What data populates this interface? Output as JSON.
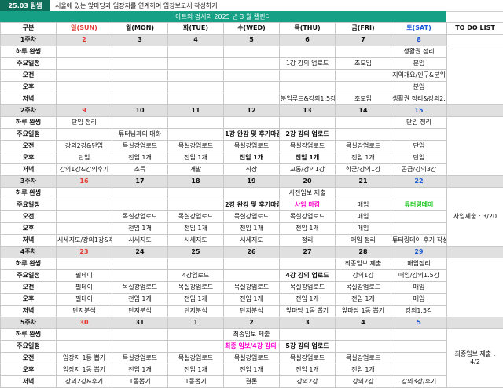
{
  "header": {
    "badge": "25.03 팀쌤",
    "headline": "서울에 있는 앞마당과 임장지를 연계하여 임장보고서 작성하기"
  },
  "title": "아트의 경서의 2025 년 3 월 캘린더",
  "columns": [
    "구분",
    "일(SUN)",
    "월(MON)",
    "화(TUE)",
    "수(WED)",
    "목(THU)",
    "금(FRI)",
    "토(SAT)",
    "TO DO LIST"
  ],
  "row_labels": [
    "하루 완씽",
    "주요일정",
    "오전",
    "오후",
    "저녁"
  ],
  "weeks": [
    {
      "label": "1주차",
      "dates": [
        "2",
        "3",
        "4",
        "5",
        "6",
        "7",
        "8"
      ],
      "rows": [
        [
          "",
          "",
          "",
          "",
          "",
          "",
          "생활권 정리"
        ],
        [
          "",
          "",
          "",
          "",
          "1강 강의 업로드",
          "조모임",
          "분임"
        ],
        [
          "",
          "",
          "",
          "",
          "",
          "",
          "지역개요/인구&분위"
        ],
        [
          "",
          "",
          "",
          "",
          "",
          "",
          "분임"
        ],
        [
          "",
          "",
          "",
          "",
          "분임루트&강의1.5강",
          "조모임",
          "생활권 정리&강의2.5강"
        ]
      ],
      "todo": ""
    },
    {
      "label": "2주차",
      "dates": [
        "9",
        "10",
        "11",
        "12",
        "13",
        "14",
        "15"
      ],
      "rows": [
        [
          "단임 정리",
          "",
          "",
          "",
          "",
          "",
          "단임 정리"
        ],
        [
          "",
          "튜터님과의 대화",
          "",
          "1강 완강 및 후기마감",
          "2강 강의 업로드",
          "",
          ""
        ],
        [
          "강의2강&단임",
          "목실강업로드",
          "목실강업로드",
          "목실강업로드",
          "목실강업로드",
          "목실강업로드",
          "단임"
        ],
        [
          "단임",
          "전임 1개",
          "전임 1개",
          "전임 1개",
          "전임 1개",
          "전임 1개",
          "단임"
        ],
        [
          "강의1강&강의후기",
          "소득",
          "개발",
          "직장",
          "교통/강의1강",
          "학군/강의1강",
          "공급/강의3강"
        ]
      ],
      "todo": ""
    },
    {
      "label": "3주차",
      "dates": [
        "16",
        "17",
        "18",
        "19",
        "20",
        "21",
        "22"
      ],
      "rows": [
        [
          "",
          "",
          "",
          "",
          "사전임보 제출",
          "",
          ""
        ],
        [
          "",
          "",
          "",
          "2강 완강 및 후기마감",
          "사임 마감",
          "매임",
          "튜터링데이"
        ],
        [
          "",
          "목실강업로드",
          "목실강업로드",
          "목실강업로드",
          "목실강업로드",
          "매임",
          ""
        ],
        [
          "",
          "전임 1개",
          "전임 1개",
          "전임 1개",
          "전임 1개",
          "매임",
          ""
        ],
        [
          "시세지도/강의1강&후기",
          "시세지도",
          "시세지도",
          "시세지도",
          "정리",
          "매임 정리",
          "튜터링데이 후기 작성"
        ]
      ],
      "todo": "사임제출 : 3/20"
    },
    {
      "label": "4주차",
      "dates": [
        "23",
        "24",
        "25",
        "26",
        "27",
        "28",
        "29"
      ],
      "rows": [
        [
          "",
          "",
          "",
          "",
          "",
          "최종임보 제출",
          "매임정리"
        ],
        [
          "필데이",
          "",
          "4강업로드",
          "",
          "4강 강의 업로드",
          "강의1강",
          "매임/강의1.5강"
        ],
        [
          "필데이",
          "목실강업로드",
          "목실강업로드",
          "목실강업로드",
          "목실강업로드",
          "목실강업로드",
          "매임"
        ],
        [
          "필데이",
          "전임 1개",
          "전임 1개",
          "전임 1개",
          "전임 1개",
          "전임 1개",
          "매임"
        ],
        [
          "단지분석",
          "단지분석",
          "단지분석",
          "단지분석",
          "앞마당 1동 뽑기",
          "앞마당 1동 뽑기",
          "강의1.5강"
        ]
      ],
      "todo": ""
    },
    {
      "label": "5주차",
      "dates": [
        "30",
        "31",
        "1",
        "2",
        "3",
        "4",
        "5"
      ],
      "rows": [
        [
          "",
          "",
          "",
          "최종임보 제출",
          "",
          "",
          ""
        ],
        [
          "",
          "",
          "",
          "최종 임보/4강 강의 마감",
          "5강 강의 업로드",
          "",
          ""
        ],
        [
          "임장지 1동 뽑기",
          "목실강업로드",
          "목실강업로드",
          "목실강업로드",
          "목실강업로드",
          "목실강업로드",
          ""
        ],
        [
          "임장지 1동 뽑기",
          "전임 1개",
          "전임 1개",
          "전임 1개",
          "전임 1개",
          "전임 1개",
          ""
        ],
        [
          "강의2강&후기",
          "1동뽑기",
          "1동뽑기",
          "결론",
          "강의2강",
          "강의2강",
          "강의3강/후기"
        ]
      ],
      "todo": "최종임보 제출 : 4/2"
    }
  ],
  "colors": {
    "badge": "#0f6e5a",
    "title_bar": "#16a085",
    "sunday": "#e53935",
    "saturday": "#1e5bd8",
    "week_row": "#e0e0e0",
    "highlight_pink": "#ff00cc",
    "highlight_green": "#1ec71e"
  }
}
